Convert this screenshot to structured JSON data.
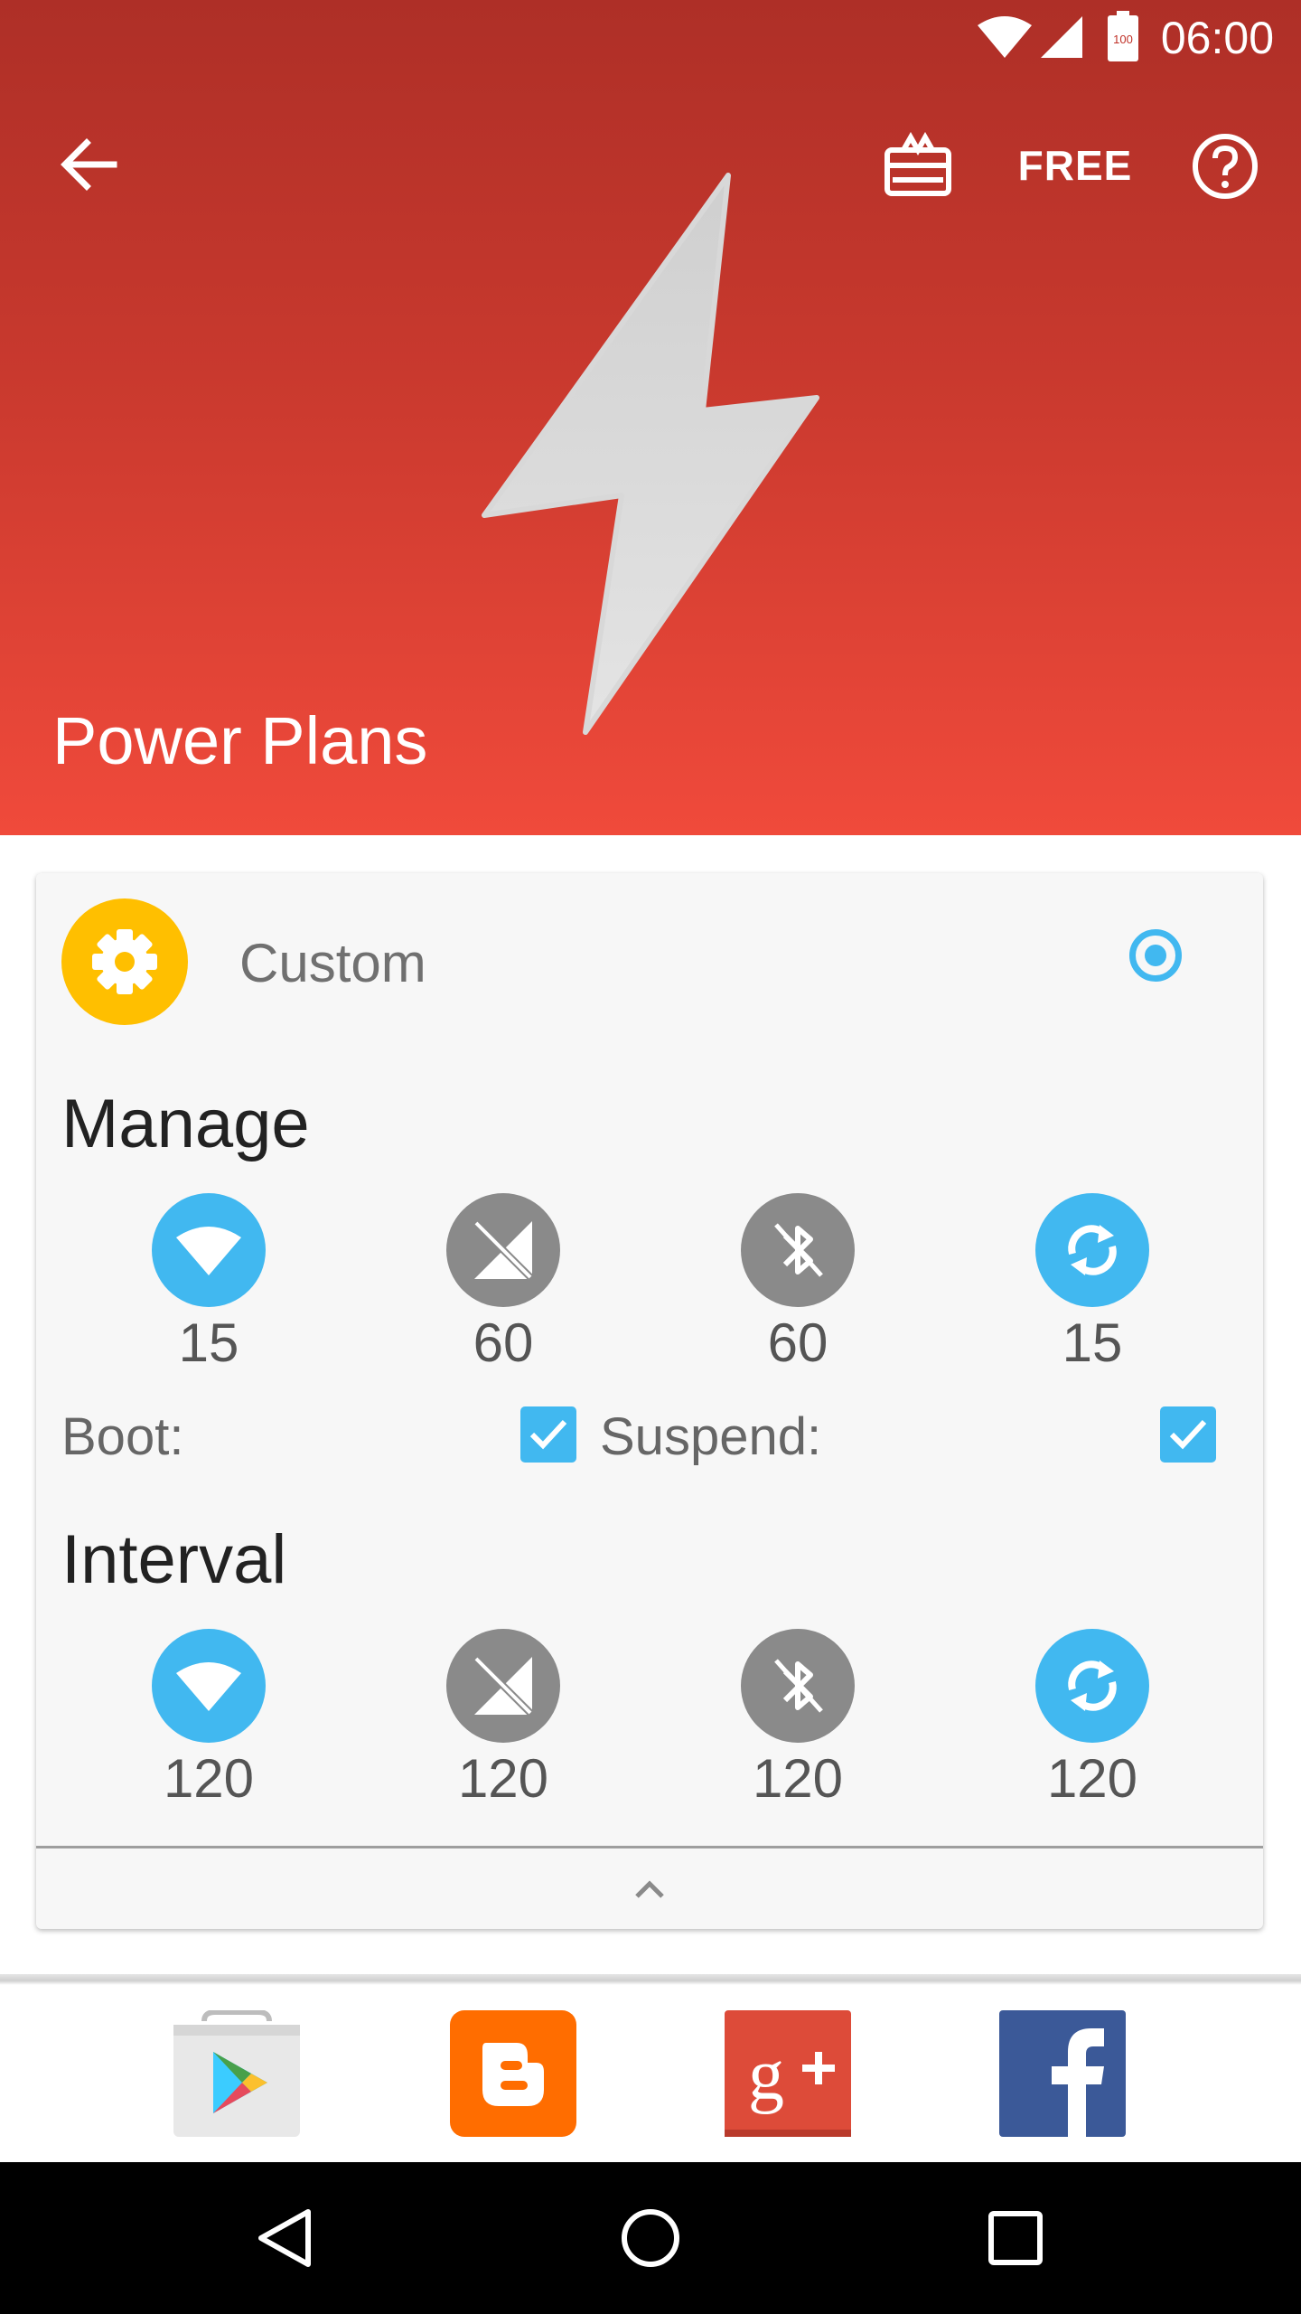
{
  "status_bar": {
    "time": "06:00",
    "battery_level": "100",
    "icons": [
      "wifi-icon",
      "cell-signal-icon",
      "battery-icon"
    ]
  },
  "toolbar": {
    "back_icon": "arrow-back-icon",
    "gift_icon": "gift-card-icon",
    "free_label": "FREE",
    "help_icon": "help-circle-icon"
  },
  "header": {
    "title": "Power Plans",
    "hero_icon": "lightning-bolt-icon",
    "gradient_top": "#ae2f27",
    "gradient_bottom": "#f04a3b"
  },
  "plan": {
    "name": "Custom",
    "icon": "gear-icon",
    "selected": true,
    "accent": "#41b8f0",
    "avatar_color": "#ffbf00"
  },
  "manage": {
    "title": "Manage",
    "items": [
      {
        "icon": "wifi-icon",
        "value": "15",
        "enabled": true
      },
      {
        "icon": "mobile-data-off-icon",
        "value": "60",
        "enabled": false
      },
      {
        "icon": "bluetooth-off-icon",
        "value": "60",
        "enabled": false
      },
      {
        "icon": "sync-icon",
        "value": "15",
        "enabled": true
      }
    ],
    "boot_label": "Boot:",
    "boot_checked": true,
    "suspend_label": "Suspend:",
    "suspend_checked": true
  },
  "interval": {
    "title": "Interval",
    "items": [
      {
        "icon": "wifi-icon",
        "value": "120",
        "enabled": true
      },
      {
        "icon": "mobile-data-off-icon",
        "value": "120",
        "enabled": false
      },
      {
        "icon": "bluetooth-off-icon",
        "value": "120",
        "enabled": false
      },
      {
        "icon": "sync-icon",
        "value": "120",
        "enabled": true
      }
    ]
  },
  "card_footer": {
    "icon": "chevron-up-icon"
  },
  "social": [
    {
      "name": "google-play-icon",
      "color": "#e8e8e8"
    },
    {
      "name": "blogger-icon",
      "color": "#ff6d00"
    },
    {
      "name": "google-plus-icon",
      "color": "#dd4b39"
    },
    {
      "name": "facebook-icon",
      "color": "#3b5998"
    }
  ],
  "nav_bar": {
    "back": "nav-back-icon",
    "home": "nav-home-icon",
    "recents": "nav-recents-icon"
  }
}
